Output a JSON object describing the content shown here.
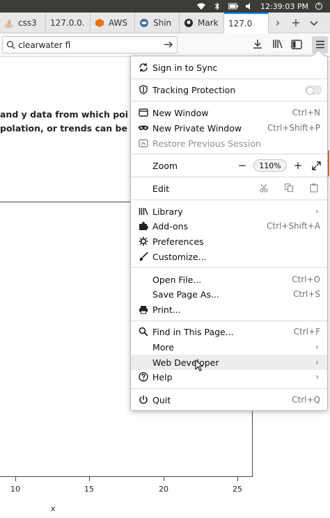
{
  "system_bar": {
    "clock": "12:39:03 PM"
  },
  "tabs": [
    {
      "label": "css3",
      "favicon_color": "#f48024"
    },
    {
      "label": "127.0.0.",
      "favicon_color": ""
    },
    {
      "label": "AWS",
      "favicon_color": "#ec7211"
    },
    {
      "label": "Shin",
      "favicon_color": "#447099"
    },
    {
      "label": "Mark",
      "favicon_color": "#24292e"
    },
    {
      "label": "127.0",
      "favicon_color": "",
      "active": true
    }
  ],
  "tab_controls": {
    "scroll_right": "›",
    "new_tab": "+",
    "list_all": "⌄"
  },
  "navbar": {
    "url_value": "clearwater fl"
  },
  "page": {
    "text_line1": "and y data from which poi",
    "text_line2": "polation, or trends can be",
    "x_ticks": [
      "10",
      "15",
      "20",
      "25"
    ],
    "x_label": "x"
  },
  "menu": {
    "sign_in": "Sign in to Sync",
    "tracking": "Tracking Protection",
    "new_window": {
      "label": "New Window",
      "shortcut": "Ctrl+N"
    },
    "new_private": {
      "label": "New Private Window",
      "shortcut": "Ctrl+Shift+P"
    },
    "restore": "Restore Previous Session",
    "zoom": {
      "label": "Zoom",
      "minus": "−",
      "value": "110%",
      "plus": "+"
    },
    "edit": "Edit",
    "library": "Library",
    "addons": {
      "label": "Add-ons",
      "shortcut": "Ctrl+Shift+A"
    },
    "preferences": "Preferences",
    "customize": "Customize...",
    "open_file": {
      "label": "Open File...",
      "shortcut": "Ctrl+O"
    },
    "save_page": {
      "label": "Save Page As...",
      "shortcut": "Ctrl+S"
    },
    "print": "Print...",
    "find": {
      "label": "Find in This Page...",
      "shortcut": "Ctrl+F"
    },
    "more": "More",
    "web_developer": "Web Developer",
    "help": "Help",
    "quit": {
      "label": "Quit",
      "shortcut": "Ctrl+Q"
    },
    "submenu_arrow": "›"
  }
}
